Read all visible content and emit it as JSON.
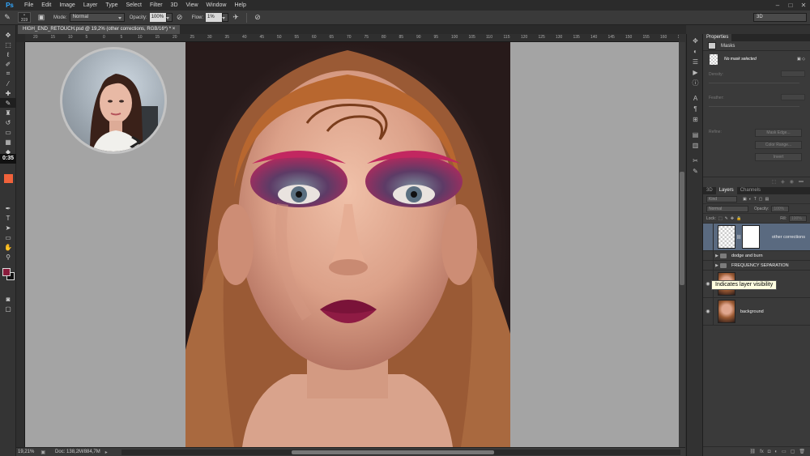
{
  "app": {
    "logo": "Ps"
  },
  "menu": [
    "File",
    "Edit",
    "Image",
    "Layer",
    "Type",
    "Select",
    "Filter",
    "3D",
    "View",
    "Window",
    "Help"
  ],
  "window_controls": [
    "–",
    "□",
    "✕"
  ],
  "options": {
    "brush_size": "319",
    "mode_label": "Mode:",
    "mode_value": "Normal",
    "opacity_label": "Opacity:",
    "opacity_value": "100%",
    "flow_label": "Flow:",
    "flow_value": "1%",
    "workspace": "3D"
  },
  "doc_tab": {
    "title": "HIGH_END_RETOUCH.psd @ 19,2% (other corrections, RGB/16*) *",
    "close": "×"
  },
  "ruler_labels": [
    "20",
    "15",
    "10",
    "5",
    "0",
    "5",
    "10",
    "15",
    "20",
    "25",
    "30",
    "35",
    "40",
    "45",
    "50",
    "55",
    "60",
    "65",
    "70",
    "75",
    "80",
    "85",
    "90",
    "95",
    "100",
    "105",
    "110",
    "115",
    "120",
    "125",
    "130",
    "135",
    "140",
    "145",
    "150",
    "155",
    "160",
    "165"
  ],
  "timer": "0:35",
  "status": {
    "zoom": "19,21%",
    "doc": "Doc: 138,2M/884,7M"
  },
  "properties": {
    "tabs": [
      "Properties"
    ],
    "header": "Masks",
    "mask_status": "No mask selected",
    "density_label": "Density:",
    "feather_label": "Feather:",
    "refine_label": "Refine:",
    "btn_mask_edge": "Mask Edge...",
    "btn_color_range": "Color Range...",
    "btn_invert": "Invert"
  },
  "layers_panel": {
    "tabs": [
      "3D",
      "Layers",
      "Channels"
    ],
    "kind": "Kind",
    "blend": "Normal",
    "opacity_label": "Opacity:",
    "opacity_value": "100%",
    "lock_label": "Lock:",
    "fill_label": "Fill:",
    "fill_value": "100%",
    "layers": [
      {
        "name": "other corrections",
        "type": "layer-mask"
      },
      {
        "name": "dodge and burn",
        "type": "group"
      },
      {
        "name": "FREQUENCY SEPARATION",
        "type": "group"
      },
      {
        "name": "blemishes",
        "type": "photo"
      },
      {
        "name": "background",
        "type": "photo"
      }
    ]
  },
  "tooltip": "Indicates layer visibility",
  "colors": {
    "accent": "#31a8ff",
    "foreground": "#8a1c3c",
    "background": "#111111",
    "swatch": "#f0623b",
    "selected_layer": "#5a6a80"
  }
}
